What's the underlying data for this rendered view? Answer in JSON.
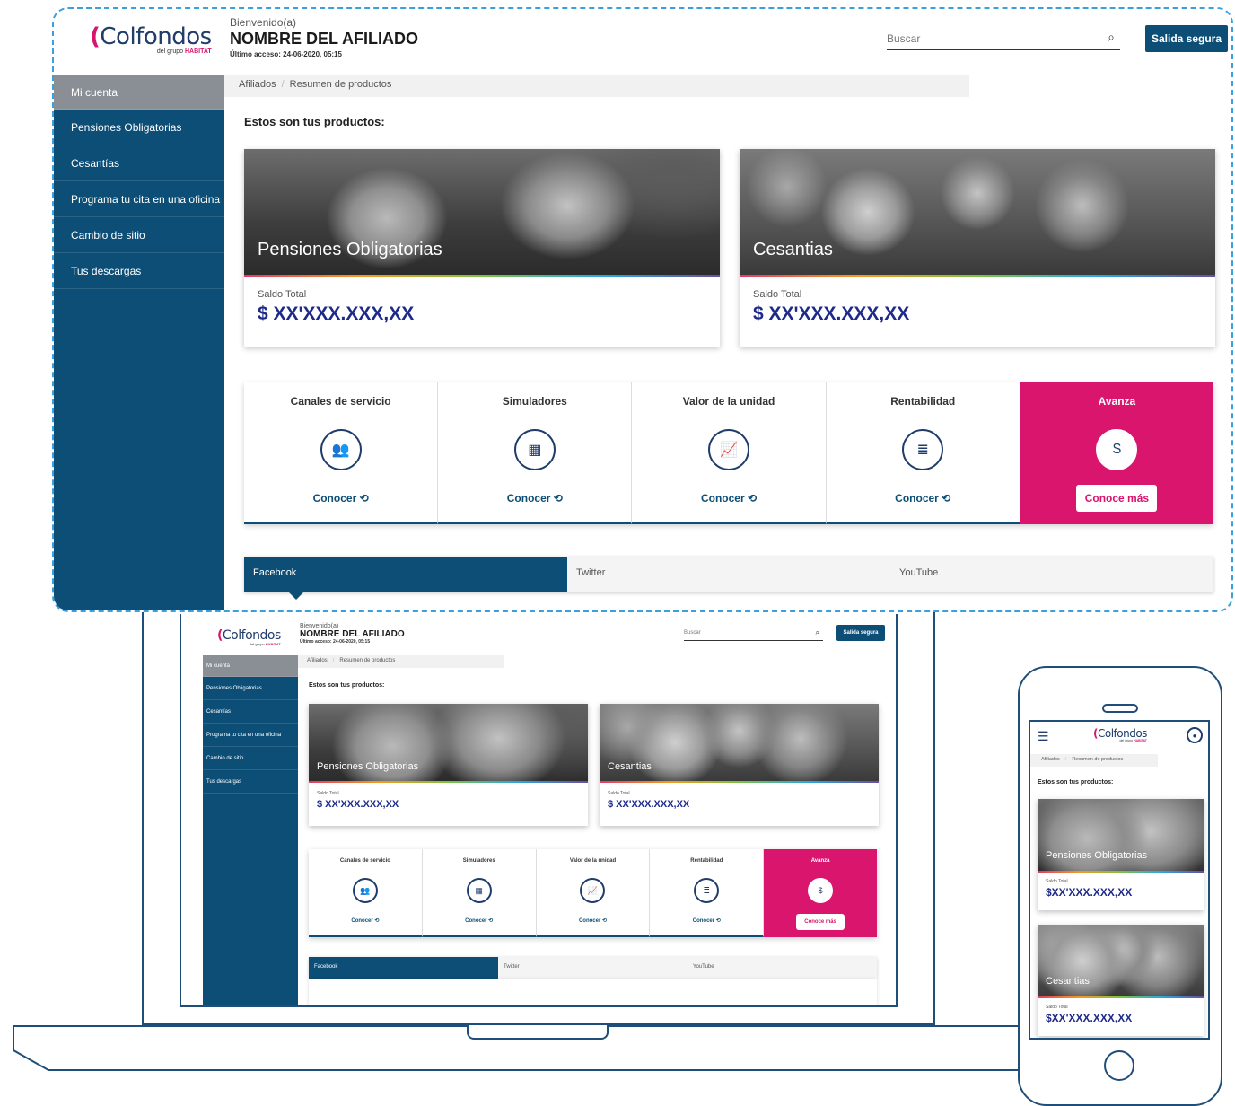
{
  "brand": {
    "logo_text": "Colfondos",
    "logo_sub_prefix": "del grupo",
    "logo_sub_brand": "HABITAT",
    "primary_color": "#0d4e76",
    "accent_color": "#d9156d",
    "amount_color": "#1d2a8a"
  },
  "header": {
    "welcome": "Bienvenido(a)",
    "name": "NOMBRE DEL AFILIADO",
    "last_access": "Último acceso: 24-06-2020, 05:15",
    "search_placeholder": "Buscar",
    "search_icon": "search-icon",
    "exit_label": "Salida segura"
  },
  "sidebar": {
    "items": [
      {
        "label": "Mi cuenta",
        "active": true
      },
      {
        "label": "Pensiones Obligatorias"
      },
      {
        "label": "Cesantías"
      },
      {
        "label": "Programa tu cita en una oficina"
      },
      {
        "label": "Cambio de sitio"
      },
      {
        "label": "Tus descargas"
      }
    ]
  },
  "breadcrumb": {
    "items": [
      "Afiliados",
      "Resumen de productos"
    ],
    "separator": "/"
  },
  "main": {
    "products_title": "Estos son tus productos:",
    "products": [
      {
        "title": "Pensiones Obligatorias",
        "saldo_label": "Saldo Total",
        "amount": "$ XX'XXX.XXX,XX"
      },
      {
        "title": "Cesantias",
        "saldo_label": "Saldo Total",
        "amount": "$ XX'XXX.XXX,XX"
      }
    ],
    "services": [
      {
        "title": "Canales de servicio",
        "icon": "users-icon",
        "glyph": "👥",
        "cta": "Conocer ⟲"
      },
      {
        "title": "Simuladores",
        "icon": "calculator-icon",
        "glyph": "▦",
        "cta": "Conocer ⟲"
      },
      {
        "title": "Valor de la unidad",
        "icon": "chart-line-icon",
        "glyph": "📈",
        "cta": "Conocer ⟲"
      },
      {
        "title": "Rentabilidad",
        "icon": "database-icon",
        "glyph": "≣",
        "cta": "Conocer ⟲"
      },
      {
        "title": "Avanza",
        "icon": "dollar-icon",
        "glyph": "$",
        "cta": "Conoce más"
      }
    ],
    "social_tabs": [
      "Facebook",
      "Twitter",
      "YouTube"
    ]
  },
  "mobile": {
    "products": [
      {
        "title": "Pensiones Obligatorias",
        "saldo_label": "Saldo Total",
        "amount": "$XX'XXX.XXX,XX"
      },
      {
        "title": "Cesantias",
        "saldo_label": "Saldo Total",
        "amount": "$XX'XXX.XXX,XX"
      }
    ]
  }
}
